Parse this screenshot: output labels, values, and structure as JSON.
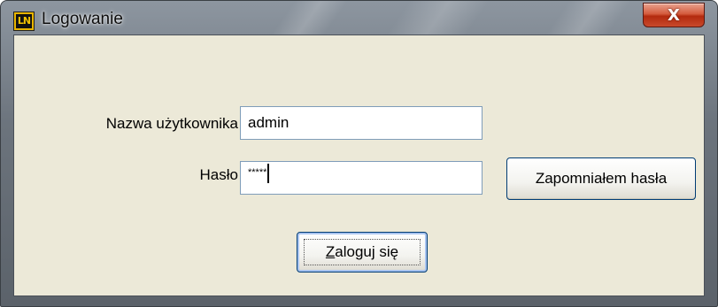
{
  "window": {
    "title": "Logowanie",
    "close_label": "X",
    "app_icon_text": "LN"
  },
  "form": {
    "username_label": "Nazwa użytkownika",
    "username_value": "admin",
    "password_label": "Hasło",
    "password_mask": "*****"
  },
  "buttons": {
    "forgot_label": "Zapomniałem hasła",
    "login_accesskey": "Z",
    "login_label_rest": "aloguj się"
  },
  "colors": {
    "client_background": "#ece9d8",
    "close_button": "#c8492c",
    "button_border": "#003c74"
  }
}
